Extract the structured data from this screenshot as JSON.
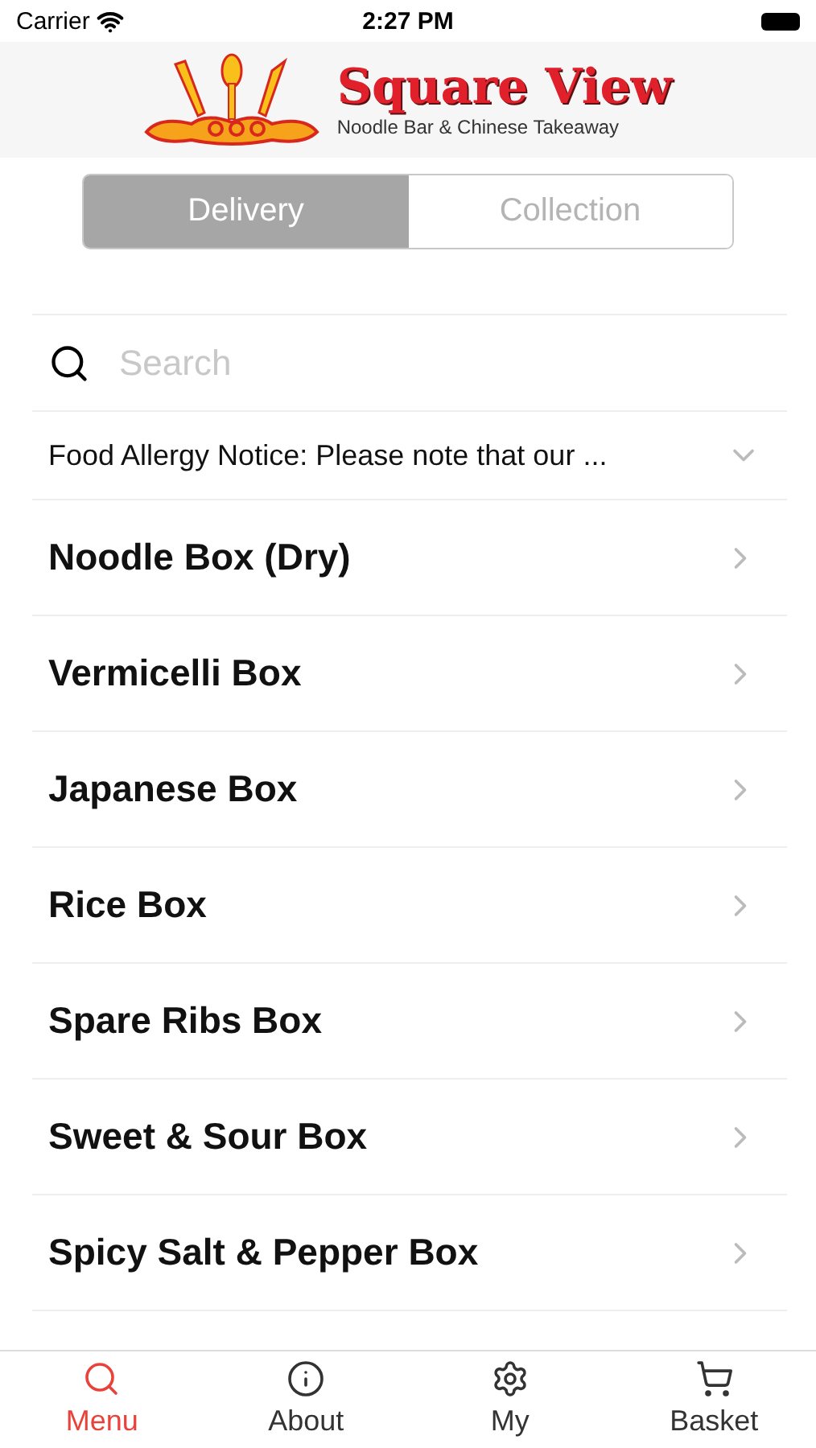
{
  "status_bar": {
    "carrier": "Carrier",
    "time": "2:27 PM"
  },
  "header": {
    "logo_title": "Square View",
    "logo_subtitle": "Noodle Bar & Chinese Takeaway"
  },
  "order_type": [
    {
      "label": "Delivery",
      "selected": true
    },
    {
      "label": "Collection",
      "selected": false
    }
  ],
  "search": {
    "placeholder": "Search"
  },
  "notice": {
    "text": "Food Allergy Notice: Please note that our ...",
    "expanded": false
  },
  "categories": [
    "Noodle Box (Dry)",
    "Vermicelli Box",
    "Japanese Box",
    "Rice Box",
    "Spare Ribs Box",
    "Sweet & Sour Box",
    "Spicy Salt & Pepper Box"
  ],
  "tab_bar": [
    {
      "label": "Menu",
      "kind": "search",
      "selected": true
    },
    {
      "label": "About",
      "kind": "info",
      "selected": false
    },
    {
      "label": "My",
      "kind": "settings",
      "selected": false
    },
    {
      "label": "Basket",
      "kind": "cart",
      "selected": false
    }
  ]
}
